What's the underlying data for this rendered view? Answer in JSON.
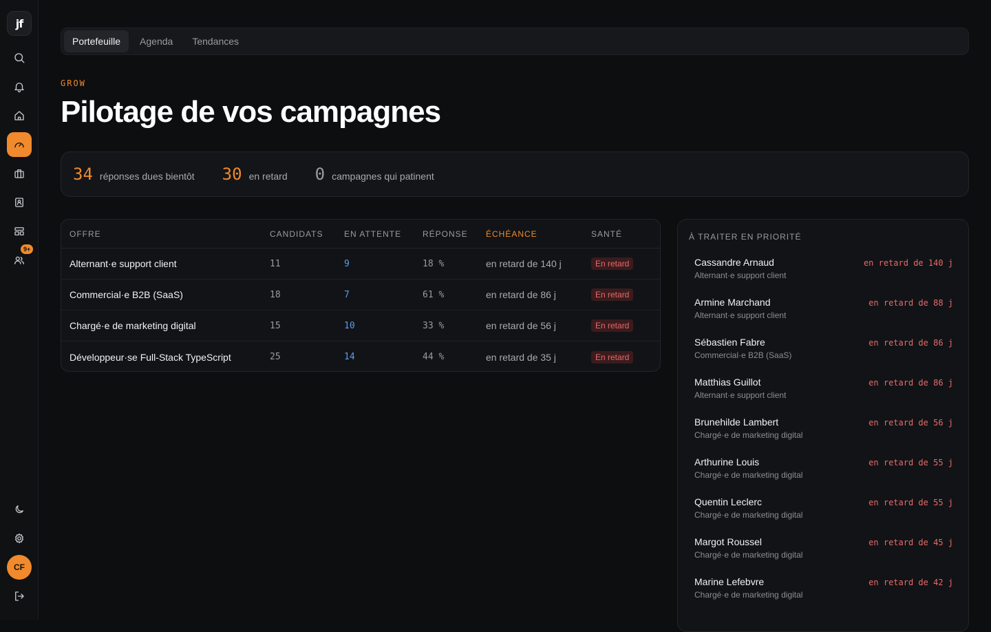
{
  "sidebar": {
    "logo": "jf",
    "notification_badge": "9+",
    "avatar_initials": "CF"
  },
  "tabs": [
    "Portefeuille",
    "Agenda",
    "Tendances"
  ],
  "header": {
    "eyebrow": "GROW",
    "title": "Pilotage de vos campagnes"
  },
  "stats": [
    {
      "value": "34",
      "label": "réponses dues bientôt"
    },
    {
      "value": "30",
      "label": "en retard"
    },
    {
      "value": "0",
      "label": "campagnes qui patinent"
    }
  ],
  "table": {
    "headers": [
      "OFFRE",
      "CANDIDATS",
      "EN ATTENTE",
      "RÉPONSE",
      "ÉCHÉANCE",
      "SANTÉ"
    ],
    "rows": [
      {
        "offer": "Alternant·e support client",
        "candidates": "11",
        "pending": "9",
        "response": "18 %",
        "due": "en retard de 140 j",
        "health": "En retard"
      },
      {
        "offer": "Commercial·e B2B (SaaS)",
        "candidates": "18",
        "pending": "7",
        "response": "61 %",
        "due": "en retard de 86 j",
        "health": "En retard"
      },
      {
        "offer": "Chargé·e de marketing digital",
        "candidates": "15",
        "pending": "10",
        "response": "33 %",
        "due": "en retard de 56 j",
        "health": "En retard"
      },
      {
        "offer": "Développeur·se Full-Stack TypeScript",
        "candidates": "25",
        "pending": "14",
        "response": "44 %",
        "due": "en retard de 35 j",
        "health": "En retard"
      }
    ]
  },
  "priority": {
    "title": "À TRAITER EN PRIORITÉ",
    "items": [
      {
        "name": "Cassandre Arnaud",
        "offer": "Alternant·e support client",
        "late": "en retard de 140 j"
      },
      {
        "name": "Armine Marchand",
        "offer": "Alternant·e support client",
        "late": "en retard de 88 j"
      },
      {
        "name": "Sébastien Fabre",
        "offer": "Commercial·e B2B (SaaS)",
        "late": "en retard de 86 j"
      },
      {
        "name": "Matthias Guillot",
        "offer": "Alternant·e support client",
        "late": "en retard de 86 j"
      },
      {
        "name": "Brunehilde Lambert",
        "offer": "Chargé·e de marketing digital",
        "late": "en retard de 56 j"
      },
      {
        "name": "Arthurine Louis",
        "offer": "Chargé·e de marketing digital",
        "late": "en retard de 55 j"
      },
      {
        "name": "Quentin Leclerc",
        "offer": "Chargé·e de marketing digital",
        "late": "en retard de 55 j"
      },
      {
        "name": "Margot Roussel",
        "offer": "Chargé·e de marketing digital",
        "late": "en retard de 45 j"
      },
      {
        "name": "Marine Lefebvre",
        "offer": "Chargé·e de marketing digital",
        "late": "en retard de 42 j"
      }
    ]
  },
  "colors": {
    "accent": "#f08a2c",
    "danger": "#e86a6a",
    "link": "#5b9cf0",
    "background": "#0d0e10"
  }
}
